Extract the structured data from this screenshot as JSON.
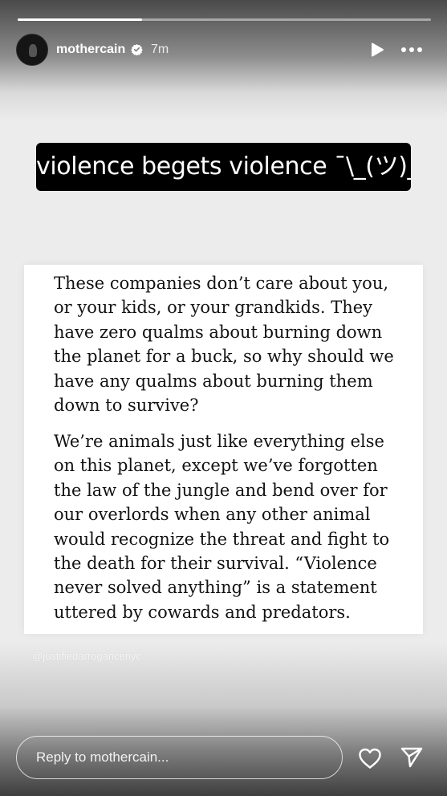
{
  "story": {
    "progress": 0.3,
    "username": "mothercain",
    "verified": true,
    "time": "7m"
  },
  "caption": "violence begets violence ¯\\_(ツ)_/¯",
  "quote": {
    "paragraph1": "These companies don’t care about you, or your kids, or your grandkids. They have zero qualms about burning down the planet for a buck, so why should we have any qualms about burning them down to survive?",
    "paragraph2": "We’re animals just like everything else on this planet, except we’ve forgotten the law of the jungle and bend over for our overlords when any other animal would recognize the threat and fight to the death for their survival. “Violence never solved anything” is a statement uttered by cowards and predators."
  },
  "watermark": "@justifiedarrogancenyc",
  "reply": {
    "placeholder": "Reply to mothercain..."
  },
  "icons": {
    "play": "play-icon",
    "more": "more-icon",
    "like": "heart-icon",
    "send": "send-icon",
    "verified": "verified-badge-icon"
  }
}
